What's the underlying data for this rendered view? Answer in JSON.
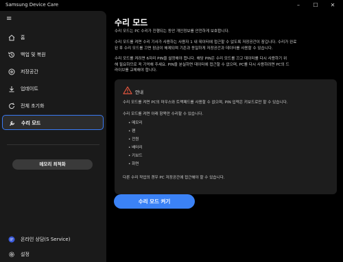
{
  "app": {
    "title": "Samsung Device Care"
  },
  "window_controls": {
    "minimize": "–",
    "maximize": "☐",
    "close": "✕"
  },
  "sidebar": {
    "menu_icon": "≡",
    "items": [
      {
        "label": "홈",
        "icon": "home-icon"
      },
      {
        "label": "백업 및 복원",
        "icon": "backup-icon"
      },
      {
        "label": "저장공간",
        "icon": "storage-icon"
      },
      {
        "label": "업데이트",
        "icon": "download-icon"
      },
      {
        "label": "전체 초기화",
        "icon": "reset-icon"
      },
      {
        "label": "수리 모드",
        "icon": "wrench-icon",
        "active": true
      }
    ],
    "memory_button": "메모리 최적화",
    "footer": [
      {
        "label": "온라인 상담(S Service)",
        "icon": "chat-icon"
      },
      {
        "label": "설정",
        "icon": "gear-icon"
      }
    ]
  },
  "main": {
    "title": "수리 모드",
    "p1": "수리 모드는 PC 수리가 진행되는 동안 개인정보를 안전하게 보호합니다.",
    "p2a": "수리 모드를 켜면 수리 기사가 사용하는 사용자 1 내 데이터에 접근할 수 없도록 저장공간이 잠깁니다. 수리가 완료",
    "p2b": "된 후 수리 모드를 끄면 잠금이 해제되며 기존과 동일하게 저장공간과 데이터를 사용할 수 있습니다.",
    "p3a": "수리 모드를 켜려면 6자리 PIN을 설정해야 합니다. 해당 PIN은 수리 모드를 끄고 데이터를 다시 사용하기 위",
    "p3b": "해 필요하므로 꼭 기억해 주세요. PIN을 분실하면 데이터에 접근할 수 없으며, PC를 다시 사용하려면 PC의 드",
    "p3c": "라이브를 교체해야 합니다.",
    "notice": {
      "header": "안내",
      "line1": "수리 모드를 켜면 PC의 마우스와 트랙패드를 사용할 수 없으며, PIN 입력은 키보드로만 할 수 있습니다.",
      "line2": "수리 모드를 켜면 아래 항목만 수리할 수 있습니다.",
      "bullets": [
        "메모리",
        "팬",
        "전원",
        "배터리",
        "키보드",
        "화면"
      ],
      "line3": "다른 수리 작업의 경우 PC 저장공간에 접근해야 할 수 있습니다."
    },
    "cta": "수리 모드 켜기"
  },
  "colors": {
    "accent": "#3b82f6",
    "active_border": "#3a7bf5",
    "warning": "#e8573f"
  }
}
